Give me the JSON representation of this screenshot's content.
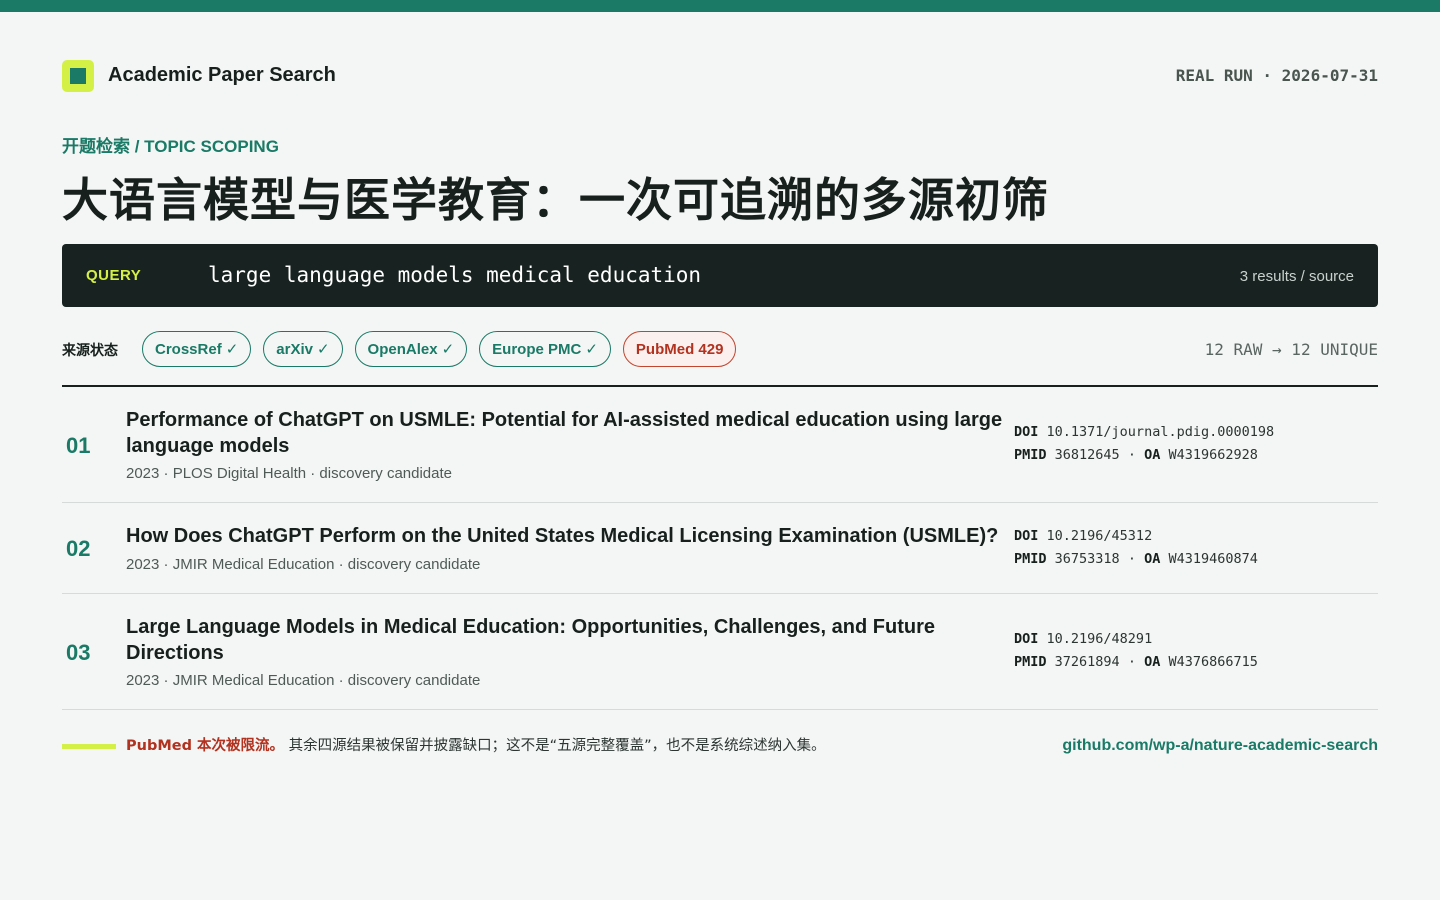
{
  "header": {
    "app_title": "Academic Paper Search",
    "run_tag": "REAL RUN · 2026-07-31"
  },
  "eyebrow": "开题检索 / TOPIC SCOPING",
  "headline": "大语言模型与医学教育：一次可追溯的多源初筛",
  "query": {
    "label": "QUERY",
    "text": "large language models medical education",
    "count": "3 results / source"
  },
  "sources": {
    "label": "来源状态",
    "chips": [
      {
        "name": "CrossRef",
        "status": "✓",
        "ok": true
      },
      {
        "name": "arXiv",
        "status": "✓",
        "ok": true
      },
      {
        "name": "OpenAlex",
        "status": "✓",
        "ok": true
      },
      {
        "name": "Europe PMC",
        "status": "✓",
        "ok": true
      },
      {
        "name": "PubMed 429",
        "status": "",
        "ok": false
      }
    ],
    "dedup": "12 RAW → 12 UNIQUE"
  },
  "results": [
    {
      "num": "01",
      "title": "Performance of ChatGPT on USMLE: Potential for AI-assisted medical education using large language models",
      "meta": "2023 · PLOS Digital Health · discovery candidate",
      "doi_label": "DOI",
      "doi": "10.1371/journal.pdig.0000198",
      "pmid_label": "PMID",
      "pmid": "36812645",
      "sep": "·",
      "oa_label": "OA",
      "oa": "W4319662928"
    },
    {
      "num": "02",
      "title": "How Does ChatGPT Perform on the United States Medical Licensing Examination (USMLE)?",
      "meta": "2023 · JMIR Medical Education · discovery candidate",
      "doi_label": "DOI",
      "doi": "10.2196/45312",
      "pmid_label": "PMID",
      "pmid": "36753318",
      "sep": "·",
      "oa_label": "OA",
      "oa": "W4319460874"
    },
    {
      "num": "03",
      "title": "Large Language Models in Medical Education: Opportunities, Challenges, and Future Directions",
      "meta": "2023 · JMIR Medical Education · discovery candidate",
      "doi_label": "DOI",
      "doi": "10.2196/48291",
      "pmid_label": "PMID",
      "pmid": "37261894",
      "sep": "·",
      "oa_label": "OA",
      "oa": "W4376866715"
    }
  ],
  "footer": {
    "warn": "PubMed 本次被限流。",
    "note": "其余四源结果被保留并披露缺口；这不是“五源完整覆盖”，也不是系统综述纳入集。",
    "repo": "github.com/wp-a/nature-academic-search"
  },
  "colors": {
    "accent": "#1a7a66",
    "highlight": "#d4f046",
    "error": "#b2321f",
    "dark": "#182220"
  }
}
